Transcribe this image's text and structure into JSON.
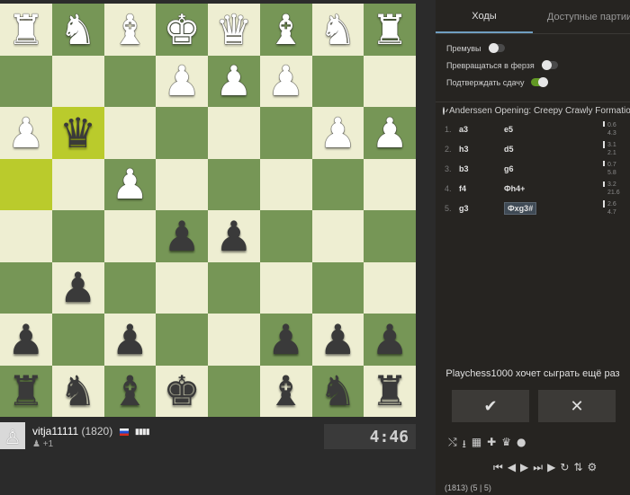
{
  "board": {
    "rows": [
      [
        "wR",
        "wN",
        "wB",
        "wK",
        "wQ",
        "wB",
        "wN",
        "wR"
      ],
      [
        "",
        "",
        "",
        "wP",
        "wP",
        "wP",
        "",
        ""
      ],
      [
        "wP",
        "bQ",
        "",
        "",
        "",
        "",
        "wP",
        "wP"
      ],
      [
        "",
        "",
        "wP",
        "",
        "",
        "",
        "",
        ""
      ],
      [
        "",
        "",
        "",
        "bP",
        "bP",
        "",
        "",
        ""
      ],
      [
        "",
        "bP",
        "",
        "",
        "",
        "",
        "",
        ""
      ],
      [
        "bP",
        "",
        "bP",
        "",
        "",
        "bP",
        "bP",
        "bP"
      ],
      [
        "bR",
        "bN",
        "bB",
        "bK",
        "",
        "bB",
        "bN",
        "bR"
      ]
    ],
    "highlight": [
      [
        2,
        1
      ],
      [
        3,
        0
      ]
    ]
  },
  "player": {
    "name": "vitja11111",
    "rating": "(1820)",
    "extra": "+1",
    "clock": "4:46"
  },
  "tabs": [
    "Ходы",
    "Доступные партии"
  ],
  "settings": [
    {
      "label": "Премувы",
      "on": false
    },
    {
      "label": "Превращаться в ферзя",
      "on": false
    },
    {
      "label": "Подтверждать сдачу",
      "on": true
    }
  ],
  "opening": "Anderssen Opening: Creepy Crawly Formation,",
  "moves": [
    {
      "num": "1.",
      "white": "a3",
      "black": "e5",
      "eval_top": "0.6",
      "eval_bottom": "4.3"
    },
    {
      "num": "2.",
      "white": "h3",
      "black": "d5",
      "eval_top": "3.1",
      "eval_bottom": "2.1"
    },
    {
      "num": "3.",
      "white": "b3",
      "black": "g6",
      "eval_top": "0.7",
      "eval_bottom": "5.8"
    },
    {
      "num": "4.",
      "white": "f4",
      "black": "Фh4+",
      "eval_top": "3.2",
      "eval_bottom": "21.6"
    },
    {
      "num": "5.",
      "white": "g3",
      "black": "Фxg3#",
      "eval_top": "2.6",
      "eval_bottom": "4.7"
    }
  ],
  "rematch": {
    "text": "Playchess1000 хочет сыграть ещё раз",
    "accept_icon": "check-icon",
    "decline_icon": "close-icon"
  },
  "footer": "(1813) (5 | 5)",
  "colors": {
    "light_square": "#eeeed2",
    "dark_square": "#769656",
    "highlight_square": "#bacb2c",
    "panel_bg": "#262421"
  }
}
